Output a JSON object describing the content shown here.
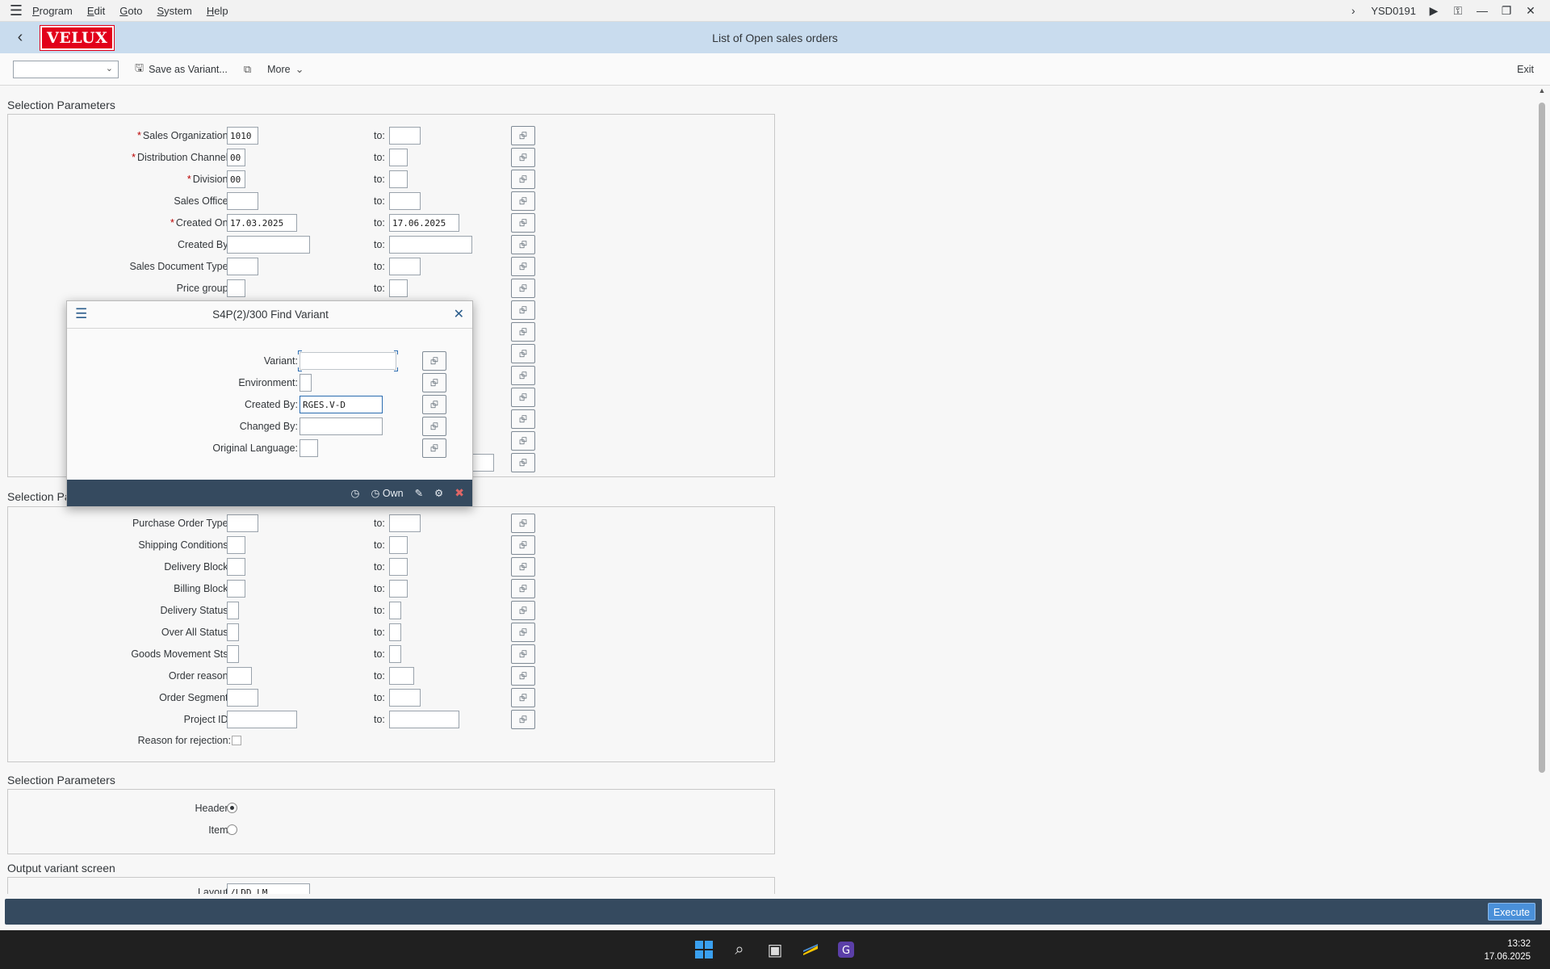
{
  "menubar": {
    "items": [
      "Program",
      "Edit",
      "Goto",
      "System",
      "Help"
    ],
    "transaction": "YSD0191"
  },
  "titlebar": {
    "logo": "VELUX",
    "title": "List of Open sales orders"
  },
  "toolbar": {
    "variant_value": "",
    "save_variant": "Save as Variant...",
    "more": "More",
    "exit": "Exit"
  },
  "sections": {
    "s1": "Selection Parameters",
    "s2": "Selection Pa",
    "s3": "Selection Parameters",
    "s4": "Output variant screen"
  },
  "sel1": {
    "to_label": "to:",
    "rows": [
      {
        "label": "Sales Organization:",
        "from": "1010",
        "to": ""
      },
      {
        "label": "Distribution Channel:",
        "from": "00",
        "to": ""
      },
      {
        "label": "Division:",
        "from": "00",
        "to": ""
      },
      {
        "label": "Sales Office:",
        "from": "",
        "to": ""
      },
      {
        "label": "Created On:",
        "from": "17.03.2025",
        "to": "17.06.2025"
      },
      {
        "label": "Created By:",
        "from": "",
        "to": ""
      },
      {
        "label": "Sales Document Type:",
        "from": "",
        "to": ""
      },
      {
        "label": "Price group:",
        "from": "",
        "to": ""
      }
    ]
  },
  "sel2": {
    "rows": [
      {
        "label": "Purchase Order Type:",
        "from": "",
        "to": ""
      },
      {
        "label": "Shipping Conditions:",
        "from": "",
        "to": ""
      },
      {
        "label": "Delivery Block:",
        "from": "",
        "to": ""
      },
      {
        "label": "Billing Block:",
        "from": "",
        "to": ""
      },
      {
        "label": "Delivery Status:",
        "from": "",
        "to": ""
      },
      {
        "label": "Over All Status:",
        "from": "",
        "to": ""
      },
      {
        "label": "Goods Movement Sts:",
        "from": "",
        "to": ""
      },
      {
        "label": "Order reason:",
        "from": "",
        "to": ""
      },
      {
        "label": "Order Segment:",
        "from": "",
        "to": ""
      },
      {
        "label": "Project ID:",
        "from": "",
        "to": ""
      }
    ],
    "rejection_label": "Reason for rejection:",
    "rejection_checked": false
  },
  "sel3": {
    "header_label": "Header:",
    "item_label": "Item:",
    "selected": "header"
  },
  "output": {
    "layout_label": "Layout:",
    "layout_value": "/LDD_LM"
  },
  "footer": {
    "execute": "Execute"
  },
  "dialog": {
    "title": "S4P(2)/300 Find Variant",
    "fields": [
      {
        "label": "Variant:",
        "value": ""
      },
      {
        "label": "Environment:",
        "value": ""
      },
      {
        "label": "Created By:",
        "value": "RGES.V-D"
      },
      {
        "label": "Changed By:",
        "value": ""
      },
      {
        "label": "Original Language:",
        "value": ""
      }
    ],
    "own_label": "Own"
  },
  "taskbar": {
    "time": "13:32",
    "date": "17.06.2025"
  },
  "colors": {
    "title_bar": "#c9dcee",
    "footer": "#354a5f",
    "execute_button": "#4a90d9",
    "logo": "#e2001a",
    "required": "#bb0000"
  }
}
